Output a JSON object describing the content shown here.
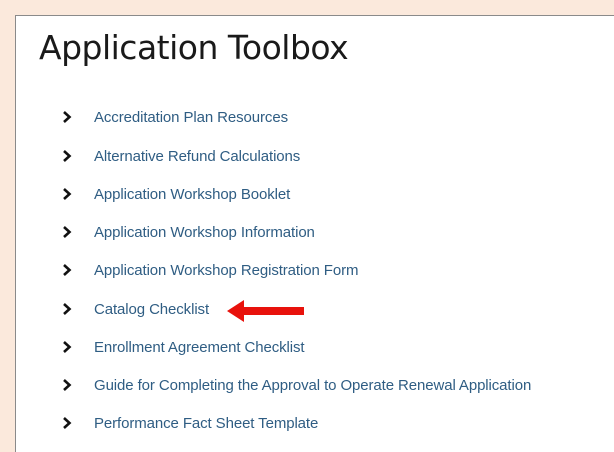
{
  "page": {
    "title": "Application Toolbox"
  },
  "links": [
    {
      "label": "Accreditation Plan Resources",
      "icon": "chevron-right-icon"
    },
    {
      "label": "Alternative Refund Calculations",
      "icon": "chevron-right-icon"
    },
    {
      "label": "Application Workshop Booklet",
      "icon": "chevron-right-icon"
    },
    {
      "label": "Application Workshop Information",
      "icon": "chevron-right-icon"
    },
    {
      "label": "Application Workshop Registration Form",
      "icon": "chevron-right-icon"
    },
    {
      "label": "Catalog Checklist",
      "icon": "chevron-right-icon"
    },
    {
      "label": "Enrollment Agreement Checklist",
      "icon": "chevron-right-icon"
    },
    {
      "label": "Guide for Completing the Approval to Operate Renewal Application",
      "icon": "chevron-right-icon"
    },
    {
      "label": "Performance Fact Sheet Template",
      "icon": "chevron-right-icon"
    }
  ],
  "annotation": {
    "icon": "left-arrow-icon",
    "color": "#e8120c"
  },
  "colors": {
    "background": "#fbe9dc",
    "panel": "#ffffff",
    "link": "#2f5d83",
    "title": "#1a1a1a",
    "chevron": "#111111"
  }
}
